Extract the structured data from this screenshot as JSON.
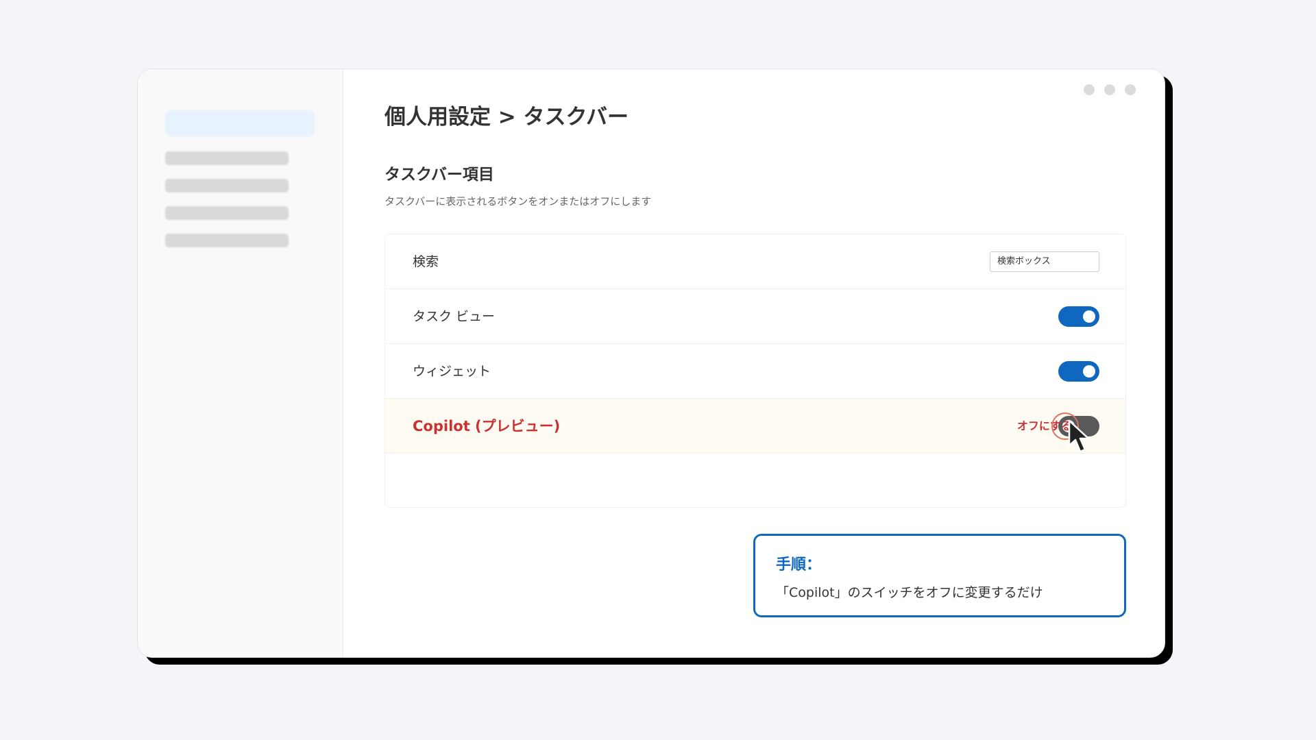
{
  "breadcrumb": {
    "title": "個人用設定 > タスクバー"
  },
  "section": {
    "title": "タスクバー項目",
    "description": "タスクバーに表示されるボタンをオンまたはオフにします"
  },
  "rows": [
    {
      "label": "検索",
      "control": "dropdown",
      "value": "検索ボックス"
    },
    {
      "label": "タスク ビュー",
      "control": "toggle",
      "state": "on"
    },
    {
      "label": "ウィジェット",
      "control": "toggle",
      "state": "on"
    },
    {
      "label": "Copilot (プレビュー)",
      "control": "toggle",
      "state": "on",
      "highlighted": true,
      "action_hint": "オフにする"
    }
  ],
  "instruction": {
    "title": "手順：",
    "text": "「Copilot」のスイッチをオフに変更するだけ"
  },
  "icons": {
    "window_controls": [
      "window-dot-icon",
      "window-dot-icon",
      "window-dot-icon"
    ],
    "cursor": "mouse-cursor-icon"
  },
  "colors": {
    "accent": "#0f67c0",
    "highlight_text": "#c83232",
    "highlight_row_bg": "#fefcf2",
    "toggle_off": "#595959"
  }
}
